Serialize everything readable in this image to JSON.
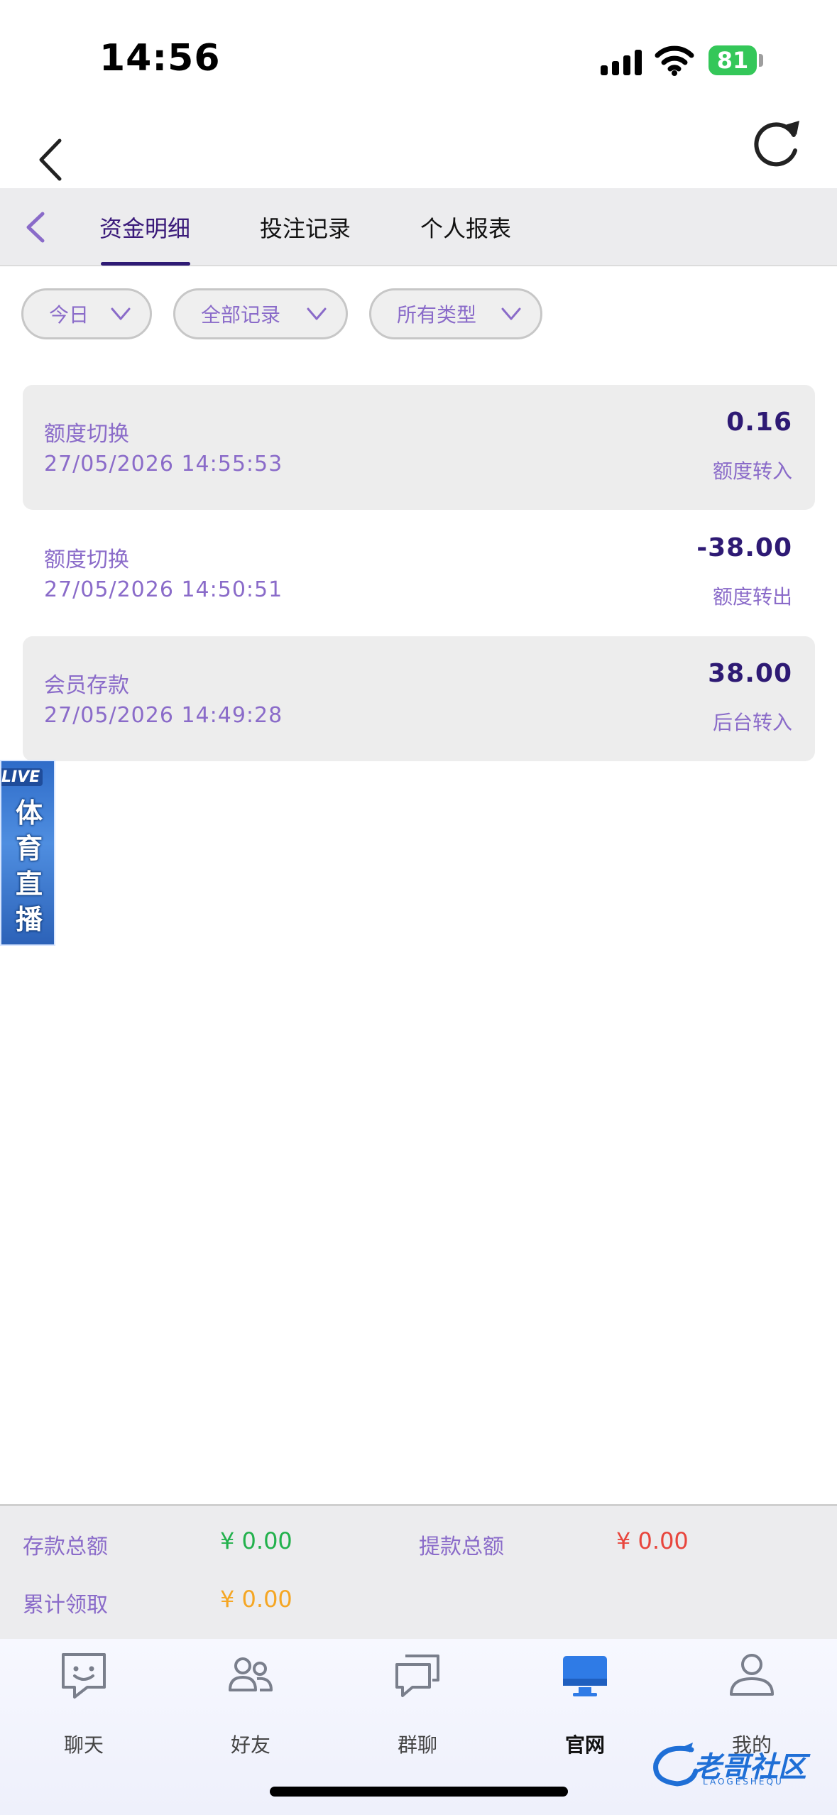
{
  "status": {
    "time": "14:56",
    "battery": "81"
  },
  "tabs": [
    {
      "label": "资金明细",
      "active": true
    },
    {
      "label": "投注记录",
      "active": false
    },
    {
      "label": "个人报表",
      "active": false
    }
  ],
  "filters": [
    {
      "label": "今日"
    },
    {
      "label": "全部记录"
    },
    {
      "label": "所有类型"
    }
  ],
  "records": [
    {
      "title": "额度切换",
      "time": "27/05/2026 14:55:53",
      "amount": "0.16",
      "type": "额度转入"
    },
    {
      "title": "额度切换",
      "time": "27/05/2026 14:50:51",
      "amount": "-38.00",
      "type": "额度转出"
    },
    {
      "title": "会员存款",
      "time": "27/05/2026 14:49:28",
      "amount": "38.00",
      "type": "后台转入"
    }
  ],
  "live_banner": {
    "tag": "LIVE",
    "text": "体育直播"
  },
  "summary": {
    "deposit_label": "存款总额",
    "deposit_value": "¥ 0.00",
    "deposit_color": "#22b14c",
    "withdraw_label": "提款总额",
    "withdraw_value": "¥ 0.00",
    "withdraw_color": "#e8453c",
    "claimed_label": "累计领取",
    "claimed_value": "¥ 0.00",
    "claimed_color": "#f5a623"
  },
  "nav": [
    {
      "label": "聊天",
      "icon": "chat-icon",
      "active": false
    },
    {
      "label": "好友",
      "icon": "friends-icon",
      "active": false
    },
    {
      "label": "群聊",
      "icon": "group-chat-icon",
      "active": false
    },
    {
      "label": "官网",
      "icon": "monitor-icon",
      "active": true
    },
    {
      "label": "我的",
      "icon": "profile-icon",
      "active": false
    }
  ],
  "watermark": {
    "text": "老哥社区",
    "sub": "LAOGESHEQU"
  },
  "colors": {
    "accent": "#2e1a74",
    "label_purple": "#8a6bc9",
    "nav_active": "#2f7be6"
  }
}
